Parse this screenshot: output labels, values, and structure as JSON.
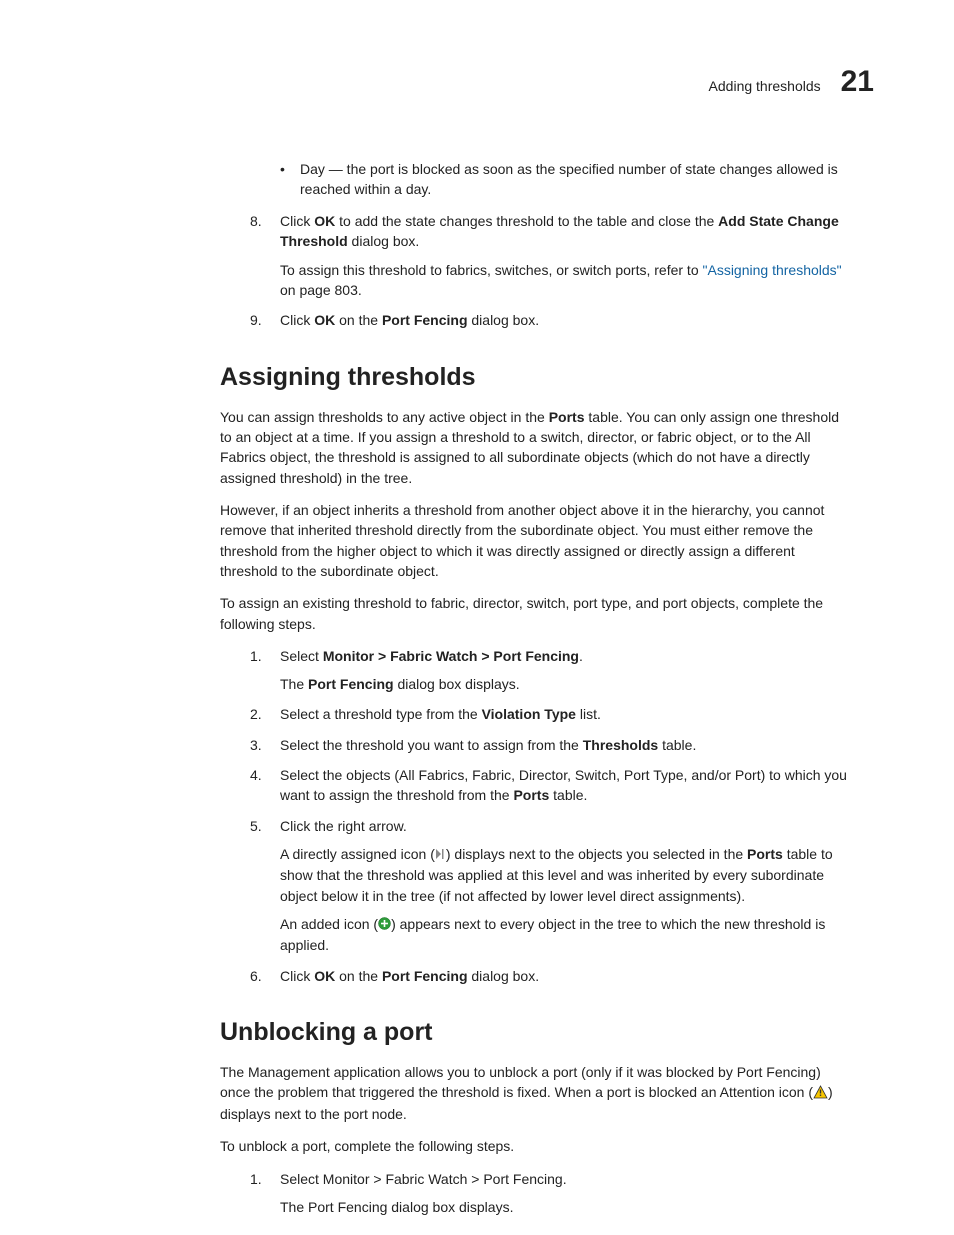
{
  "header": {
    "title": "Adding thresholds",
    "chapter": "21"
  },
  "intro_steps": {
    "bullet_day": "Day — the port is blocked as soon as the specified number of state changes allowed is reached within a day.",
    "step8_num": "8.",
    "step8_p1_a": "Click ",
    "step8_p1_ok": "OK",
    "step8_p1_b": " to add the state changes threshold to the table and close the ",
    "step8_p1_dlg": "Add State Change Threshold",
    "step8_p1_c": " dialog box.",
    "step8_p2_a": "To assign this threshold to fabrics, switches, or switch ports, refer to ",
    "step8_p2_link": "\"Assigning thresholds\"",
    "step8_p2_b": " on page 803.",
    "step9_num": "9.",
    "step9_a": "Click ",
    "step9_ok": "OK",
    "step9_b": " on the ",
    "step9_pf": "Port Fencing",
    "step9_c": " dialog box."
  },
  "assigning": {
    "heading": "Assigning thresholds",
    "p1_a": "You can assign thresholds to any active object in the ",
    "p1_ports": "Ports",
    "p1_b": " table. You can only assign one threshold to an object at a time. If you assign a threshold to a switch, director, or fabric object, or to the All Fabrics object, the threshold is assigned to all subordinate objects (which do not have a directly assigned threshold) in the tree.",
    "p2": "However, if an object inherits a threshold from another object above it in the hierarchy, you cannot remove that inherited threshold directly from the subordinate object. You must either remove the threshold from the higher object to which it was directly assigned or directly assign a different threshold to the subordinate object.",
    "p3": "To assign an existing threshold to fabric, director, switch, port type, and port objects, complete the following steps.",
    "steps": {
      "s1_num": "1.",
      "s1_a": "Select ",
      "s1_path": "Monitor > Fabric Watch > Port Fencing",
      "s1_b": ".",
      "s1_sub_a": "The ",
      "s1_sub_pf": "Port Fencing",
      "s1_sub_b": " dialog box displays.",
      "s2_num": "2.",
      "s2_a": "Select a threshold type from the ",
      "s2_vt": "Violation Type",
      "s2_b": " list.",
      "s3_num": "3.",
      "s3_a": "Select the threshold you want to assign from the ",
      "s3_th": "Thresholds",
      "s3_b": " table.",
      "s4_num": "4.",
      "s4_a": "Select the objects (All Fabrics, Fabric, Director, Switch, Port Type, and/or Port) to which you want to assign the threshold from the ",
      "s4_ports": "Ports",
      "s4_b": " table.",
      "s5_num": "5.",
      "s5_a": "Click the right arrow.",
      "s5_sub1_a": "A directly assigned icon (",
      "s5_sub1_b": ") displays next to the objects you selected in the ",
      "s5_sub1_ports": "Ports",
      "s5_sub1_c": " table to show that the threshold was applied at this level and was inherited by every subordinate object below it in the tree (if not affected by lower level direct assignments).",
      "s5_sub2_a": "An added icon (",
      "s5_sub2_b": ") appears next to every object in the tree to which the new threshold is applied.",
      "s6_num": "6.",
      "s6_a": "Click ",
      "s6_ok": "OK",
      "s6_b": " on the ",
      "s6_pf": "Port Fencing",
      "s6_c": " dialog box."
    }
  },
  "unblocking": {
    "heading": "Unblocking a port",
    "p1_a": "The Management application allows you to unblock a port (only if it was blocked by Port Fencing) once the problem that triggered the threshold is fixed. When a port is blocked an Attention icon (",
    "p1_b": ") displays next to the port node.",
    "p2": "To unblock a port, complete the following steps.",
    "s1_num": "1.",
    "s1": "Select Monitor > Fabric Watch > Port Fencing.",
    "s1_sub": "The Port Fencing dialog box displays."
  }
}
